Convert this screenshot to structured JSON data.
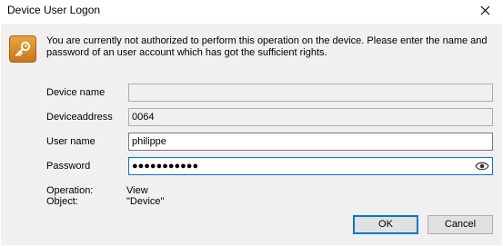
{
  "window": {
    "title": "Device User Logon",
    "close_label": "Close"
  },
  "message": "You are currently not authorized to perform this operation on the device. Please enter the name and password of an user account which has got the sufficient rights.",
  "icons": {
    "header": "key-icon",
    "password_toggle": "eye-icon",
    "close": "close-icon"
  },
  "colors": {
    "accent": "#0078d7",
    "key_icon": "#d88a26"
  },
  "form": {
    "device_name": {
      "label": "Device name",
      "value": ""
    },
    "device_address": {
      "label": "Deviceaddress",
      "value": "0064"
    },
    "user_name": {
      "label": "User name",
      "value": "philippe"
    },
    "password": {
      "label": "Password",
      "value": "●●●●●●●●●●●"
    }
  },
  "info": {
    "operation": {
      "label": "Operation:",
      "value": "View"
    },
    "object": {
      "label": "Object:",
      "value": "\"Device\""
    }
  },
  "buttons": {
    "ok": "OK",
    "cancel": "Cancel"
  }
}
